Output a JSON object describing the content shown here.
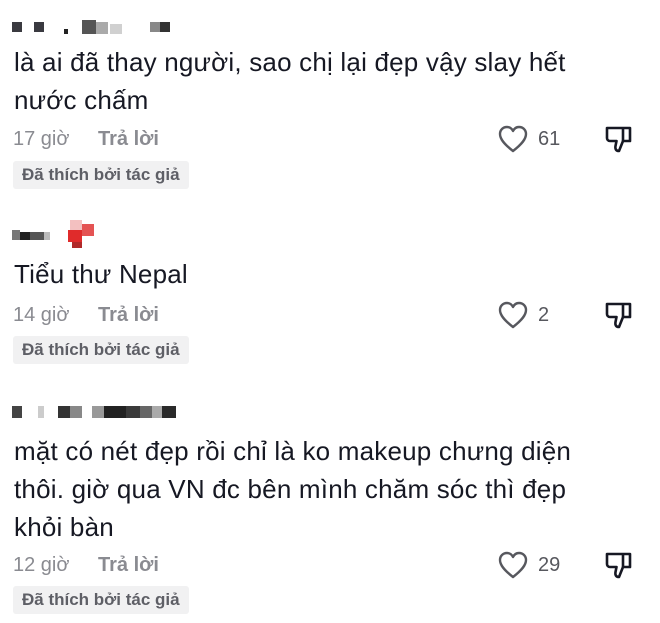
{
  "comments": [
    {
      "text": "là ai đã thay người, sao chị lại đẹp vậy slay hết nước chấm",
      "time": "17 giờ",
      "reply_label": "Trả lời",
      "likes": "61",
      "badge": "Đã thích bởi tác giả"
    },
    {
      "text": "Tiểu thư Nepal",
      "time": "14 giờ",
      "reply_label": "Trả lời",
      "likes": "2",
      "badge": "Đã thích bởi tác giả"
    },
    {
      "text": "mặt có nét đẹp rồi chỉ là ko makeup chưng diện thôi. giờ qua VN đc bên mình chăm sóc thì đẹp khỏi bàn",
      "time": "12 giờ",
      "reply_label": "Trả lời",
      "likes": "29",
      "badge": "Đã thích bởi tác giả"
    }
  ],
  "icons": {
    "like": "heart-outline-icon",
    "dislike": "thumbs-down-outline-icon"
  },
  "colors": {
    "text": "#161823",
    "muted": "#8a8b91",
    "badge_bg": "#f1f1f2",
    "badge_text": "#5e5f66",
    "censor_red": "#e02b2b"
  }
}
